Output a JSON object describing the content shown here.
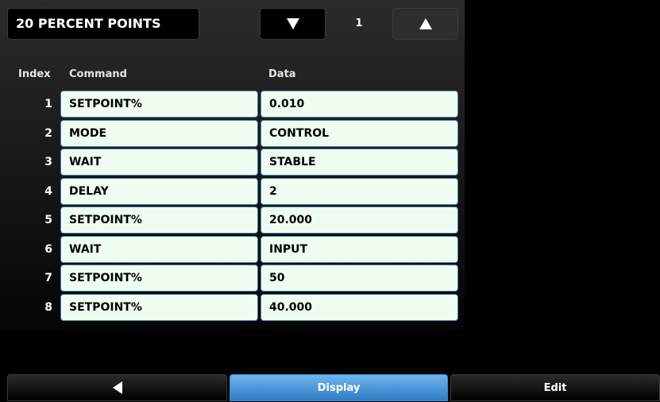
{
  "header": {
    "title": "20 PERCENT POINTS",
    "page_number": "1",
    "prev_icon": "triangle-down-icon",
    "next_icon": "triangle-up-icon"
  },
  "columns": {
    "index": "Index",
    "command": "Command",
    "data": "Data"
  },
  "rows": [
    {
      "index": "1",
      "command": "SETPOINT%",
      "data": "0.010"
    },
    {
      "index": "2",
      "command": "MODE",
      "data": "CONTROL"
    },
    {
      "index": "3",
      "command": "WAIT",
      "data": "STABLE"
    },
    {
      "index": "4",
      "command": "DELAY",
      "data": "2"
    },
    {
      "index": "5",
      "command": "SETPOINT%",
      "data": "20.000"
    },
    {
      "index": "6",
      "command": "WAIT",
      "data": "INPUT"
    },
    {
      "index": "7",
      "command": "SETPOINT%",
      "data": "50"
    },
    {
      "index": "8",
      "command": "SETPOINT%",
      "data": "40.000"
    }
  ],
  "bottom_bar": {
    "back_icon": "triangle-left-icon",
    "display_label": "Display",
    "edit_label": "Edit"
  },
  "colors": {
    "cell_bg": "#effdf0",
    "cell_border": "#4a7fa8",
    "active_tab": "#4f9ee0"
  }
}
